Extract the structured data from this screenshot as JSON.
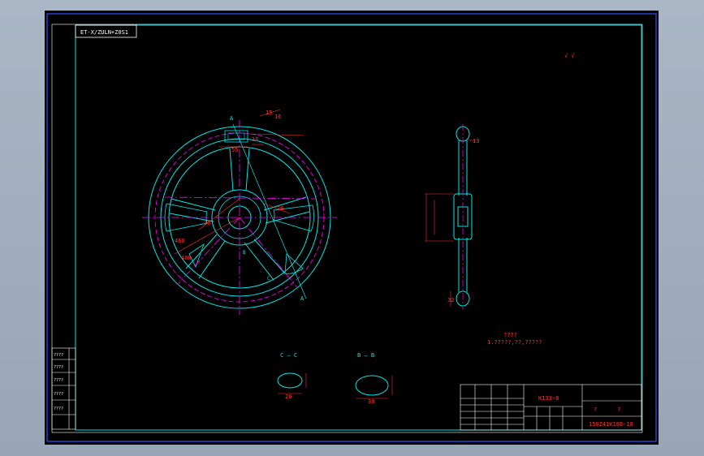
{
  "drawing": {
    "code_box": "ET-X/ZULN+Z0S1",
    "top_right_mark": "√ √",
    "section_c_label": "C — C",
    "section_b_label": "B — B",
    "notes_title": "????",
    "notes_line": "1.?????,??,?????",
    "dims": {
      "d15": "15",
      "d16": "16",
      "d18": "18",
      "d55": "55",
      "r26": "26",
      "d30": "30",
      "d36": "36",
      "d460": "460",
      "d408": "408",
      "d32": "32",
      "d26b": "26",
      "d30b": "30",
      "d13": "13"
    },
    "labels": {
      "A": "A",
      "B": "B",
      "C": "C"
    }
  },
  "title_block": {
    "drawing_no": "K133-8",
    "name_left": "?",
    "name_right": "?",
    "spec": "150Z41K18B-18"
  },
  "left_strip": {
    "rows": [
      "????",
      "????",
      "????",
      "????",
      "????"
    ]
  },
  "colors": {
    "background": "#000000",
    "frame": "#00e6e6",
    "dimension": "#ff3030",
    "centerline": "#ff00ff",
    "outer_frame": "#3050ff"
  }
}
